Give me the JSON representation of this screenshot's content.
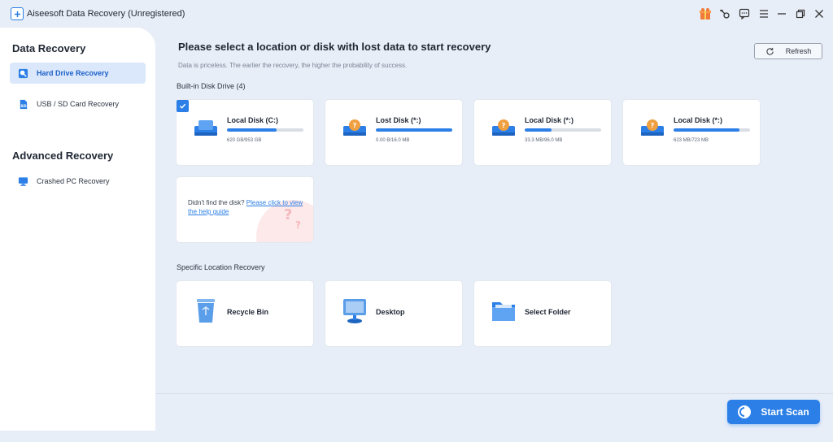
{
  "window": {
    "title": "Aiseesoft Data Recovery (Unregistered)",
    "icons": [
      "gift-icon",
      "key-icon",
      "feedback-icon",
      "menu-icon",
      "minimize-icon",
      "restore-icon",
      "close-icon"
    ]
  },
  "sidebar": {
    "section1": "Data Recovery",
    "section2": "Advanced Recovery",
    "items": [
      {
        "label": "Hard Drive Recovery",
        "icon": "hard-drive-icon",
        "active": true
      },
      {
        "label": "USB / SD Card Recovery",
        "icon": "sd-card-icon",
        "active": false
      },
      {
        "label": "Crashed PC Recovery",
        "icon": "monitor-icon",
        "active": false
      }
    ]
  },
  "main": {
    "title": "Please select a location or disk with lost data to start recovery",
    "subtitle": "Data is priceless. The earlier the recovery, the higher the probability of success.",
    "refresh_label": "Refresh",
    "builtin_label": "Built-in Disk Drive (4)",
    "disks": [
      {
        "name": "Local Disk (C:)",
        "size": "620 GB/953 GB",
        "used_fraction": 0.65,
        "selected": true
      },
      {
        "name": "Lost Disk (*:)",
        "size": "0.00  B/16.0 MB",
        "used_fraction": 1.0,
        "selected": false
      },
      {
        "name": "Local Disk (*:)",
        "size": "33.3 MB/96.0 MB",
        "used_fraction": 0.35,
        "selected": false
      },
      {
        "name": "Local Disk (*:)",
        "size": "623 MB/723 MB",
        "used_fraction": 0.86,
        "selected": false
      }
    ],
    "guide": {
      "text": "Didn't find the disk? ",
      "link": "Please click to view the help guide"
    },
    "specific_label": "Specific Location Recovery",
    "locations": [
      {
        "name": "Recycle Bin",
        "icon": "recycle-bin-icon"
      },
      {
        "name": "Desktop",
        "icon": "desktop-icon"
      },
      {
        "name": "Select Folder",
        "icon": "folder-icon"
      }
    ],
    "start_label": "Start Scan"
  },
  "colors": {
    "accent": "#2b7fe6",
    "background": "#e8eef8",
    "sidebar_active": "#dbe8fb",
    "disk_icon_orange": "#f0a040"
  }
}
